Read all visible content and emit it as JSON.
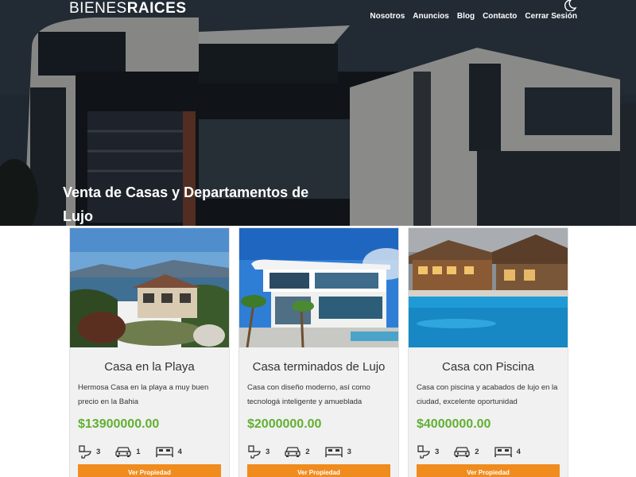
{
  "header": {
    "logo_light": "BIENES",
    "logo_bold": "RAICES",
    "theme_icon": "moon-icon",
    "nav": [
      "Nosotros",
      "Anuncios",
      "Blog",
      "Contacto",
      "Cerrar Sesión"
    ],
    "title": "Venta de Casas y Departamentos de Lujo"
  },
  "colors": {
    "accent": "#f08c1e",
    "price": "#61b032"
  },
  "listings": [
    {
      "title": "Casa en la Playa",
      "description": "Hermosa Casa en la playa a muy buen precio en la Bahia",
      "price": "$13900000.00",
      "wc": "3",
      "parking": "1",
      "rooms": "4",
      "button": "Ver Propiedad"
    },
    {
      "title": "Casa terminados de Lujo",
      "description": "Casa con diseño moderno, así como tecnologá inteligente y amueblada",
      "price": "$2000000.00",
      "wc": "3",
      "parking": "2",
      "rooms": "3",
      "button": "Ver Propiedad"
    },
    {
      "title": "Casa con Piscina",
      "description": "Casa con piscina y acabados de lujo en la ciudad, excelente oportunidad",
      "price": "$4000000.00",
      "wc": "3",
      "parking": "2",
      "rooms": "4",
      "button": "Ver Propiedad"
    }
  ]
}
